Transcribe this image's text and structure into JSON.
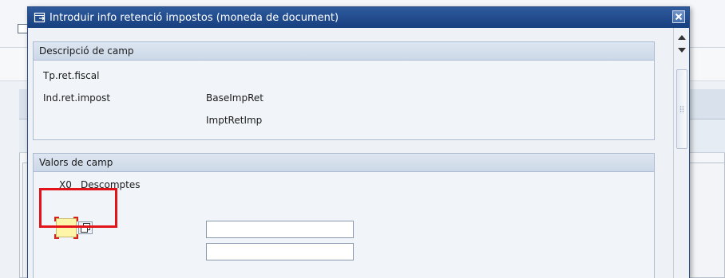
{
  "dialog": {
    "title": "Introduir info retenció impostos (moneda de document)",
    "close_label": "×"
  },
  "section1": {
    "title": "Descripció de camp",
    "label_type": "Tp.ret.fiscal",
    "label_indicator": "Ind.ret.impost",
    "label_base": "BaseImpRet",
    "label_amount": "ImptRetImp"
  },
  "section2": {
    "title": "Valors de camp",
    "row_code": "X0",
    "row_desc": "Descomptes",
    "base_value": "",
    "amount_value": ""
  },
  "colors": {
    "titlebar": "#17407f",
    "highlight": "#e3131a",
    "input_active": "#fff5a8"
  }
}
